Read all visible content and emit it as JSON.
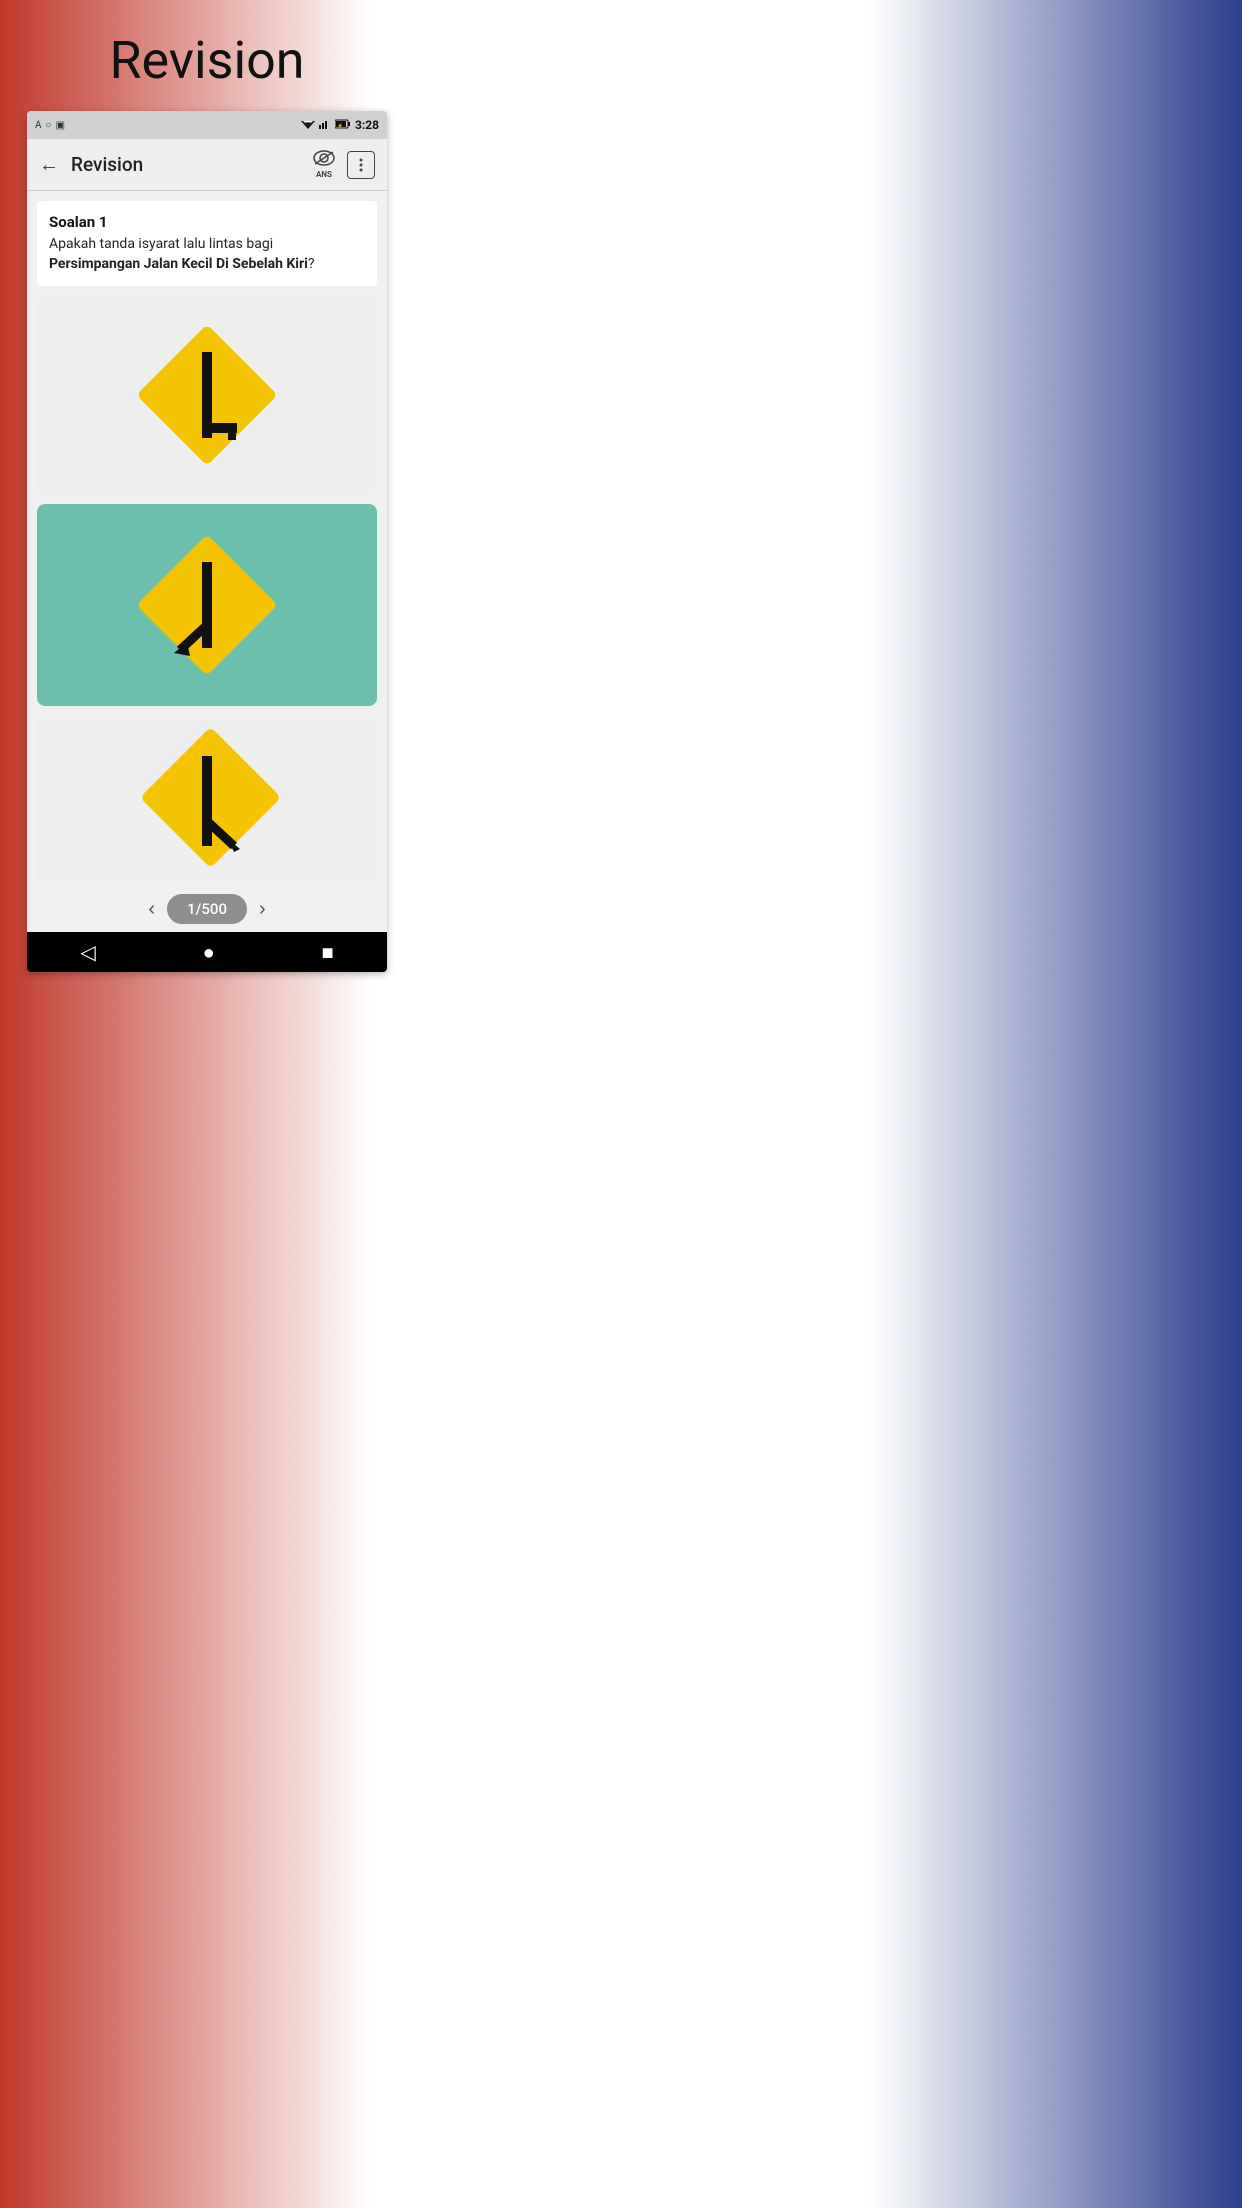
{
  "page": {
    "title": "Revision"
  },
  "statusBar": {
    "time": "3:28",
    "icons": [
      "A",
      "○",
      "▣"
    ]
  },
  "appBar": {
    "backLabel": "←",
    "title": "Revision",
    "ansLabel": "ANS",
    "menuLabel": "⋮"
  },
  "question": {
    "number": "Soalan 1",
    "text_prefix": "Apakah tanda isyarat lalu lintas bagi ",
    "text_bold": "Persimpangan Jalan Kecil Di Sebelah Kiri",
    "text_suffix": "?"
  },
  "options": [
    {
      "id": 1,
      "selected": false,
      "bg": "light"
    },
    {
      "id": 2,
      "selected": true,
      "bg": "selected"
    },
    {
      "id": 3,
      "selected": false,
      "bg": "light"
    }
  ],
  "pagination": {
    "current": "1/500",
    "prevLabel": "‹",
    "nextLabel": "›"
  },
  "navBar": {
    "back": "◁",
    "home": "●",
    "square": "■"
  }
}
